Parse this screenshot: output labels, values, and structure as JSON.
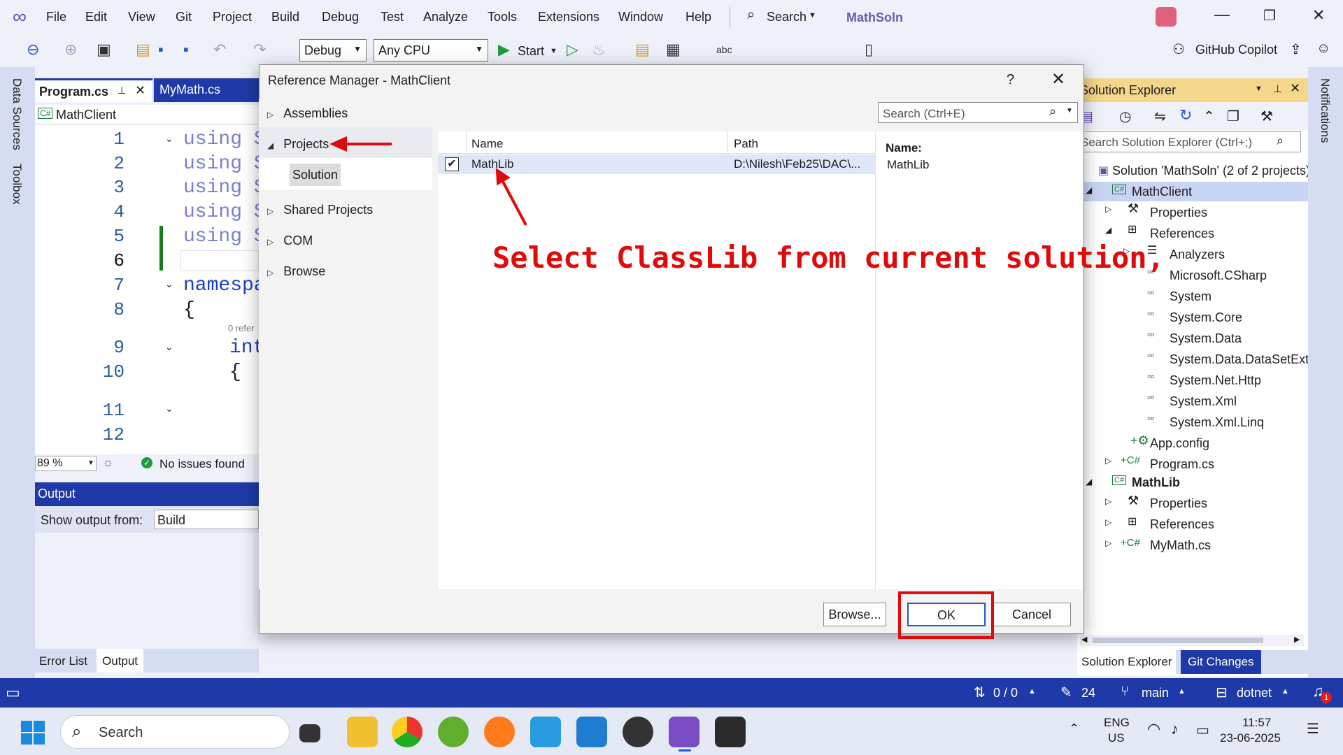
{
  "app": {
    "title": "MathSoln",
    "menu": [
      "File",
      "Edit",
      "View",
      "Git",
      "Project",
      "Build",
      "Debug",
      "Test",
      "Analyze",
      "Tools",
      "Extensions",
      "Window",
      "Help"
    ],
    "search_label": "Search",
    "copilot_label": "GitHub Copilot",
    "config_combo": "Debug",
    "platform_combo": "Any CPU",
    "start_label": "Start",
    "side_tabs": {
      "data_sources": "Data Sources",
      "toolbox": "Toolbox",
      "notifications": "Notifications"
    }
  },
  "editor": {
    "tabs": [
      "Program.cs",
      "MyMath.cs"
    ],
    "project_combo": "MathClient",
    "line_numbers": [
      "1",
      "2",
      "3",
      "4",
      "5",
      "6",
      "7",
      "8",
      "9",
      "10",
      "11",
      "12"
    ],
    "lines": [
      "using S",
      "using S",
      "using S",
      "using S",
      "using S",
      "",
      "namespa",
      "{",
      "int",
      "{"
    ],
    "codelens": "0 refer",
    "zoom": "89 %",
    "issues": "No issues found"
  },
  "output": {
    "title": "Output",
    "show_from_label": "Show output from:",
    "show_from_value": "Build"
  },
  "bottom_tabs": [
    "Error List",
    "Output"
  ],
  "dialog": {
    "title": "Reference Manager - MathClient",
    "help": "?",
    "nav": [
      "Assemblies",
      "Projects",
      "Solution",
      "Shared Projects",
      "COM",
      "Browse"
    ],
    "search_placeholder": "Search (Ctrl+E)",
    "columns": {
      "name": "Name",
      "path": "Path"
    },
    "rows": [
      {
        "name": "MathLib",
        "path": "D:\\Nilesh\\Feb25\\DAC\\...",
        "checked": true
      }
    ],
    "detail": {
      "label": "Name:",
      "value": "MathLib"
    },
    "buttons": {
      "browse": "Browse...",
      "ok": "OK",
      "cancel": "Cancel"
    }
  },
  "annotation": {
    "text": "Select ClassLib from current solution,",
    "color": "#e10a0a"
  },
  "solution_explorer": {
    "title": "Solution Explorer",
    "search_placeholder": "Search Solution Explorer (Ctrl+;)",
    "nodes": [
      "Solution 'MathSoln' (2 of 2 projects)",
      "MathClient",
      "Properties",
      "References",
      "Analyzers",
      "Microsoft.CSharp",
      "System",
      "System.Core",
      "System.Data",
      "System.Data.DataSetExtensions",
      "System.Net.Http",
      "System.Xml",
      "System.Xml.Linq",
      "App.config",
      "Program.cs",
      "MathLib",
      "Properties",
      "References",
      "MyMath.cs"
    ],
    "tabs": [
      "Solution Explorer",
      "Git Changes"
    ]
  },
  "statusbar": {
    "sync": "0 / 0",
    "edits": "24",
    "branch": "main",
    "repo": "dotnet"
  },
  "taskbar": {
    "search": "Search",
    "lang_1": "ENG",
    "lang_2": "US",
    "time": "11:57",
    "date": "23-06-2025",
    "notif_count": "1"
  },
  "colors": {
    "accent": "#1f3aa8",
    "annotation_red": "#e10a0a",
    "selected_row": "#dfe6f8"
  }
}
